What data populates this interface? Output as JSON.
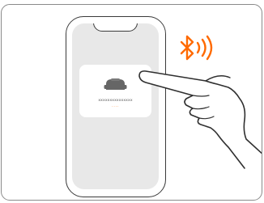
{
  "device_card": {
    "name": "xxxxxxxxxxxxxxx",
    "status_dots": "····"
  },
  "colors": {
    "accent": "#ff6a00",
    "device_icon": "#666666"
  },
  "icons": {
    "bluetooth": "bluetooth-signal-icon",
    "device": "robot-vacuum-icon",
    "hand": "pointing-hand-icon"
  }
}
